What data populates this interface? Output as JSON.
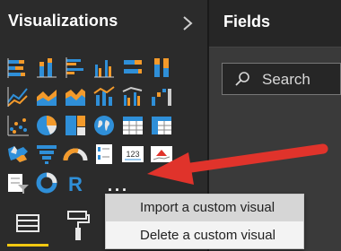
{
  "visualizations": {
    "title": "Visualizations",
    "expand_icon": "chevron-right-icon",
    "more_label": "...",
    "icons": [
      "stacked-bar-chart-icon",
      "stacked-column-chart-icon",
      "clustered-bar-chart-icon",
      "clustered-column-chart-icon",
      "100-percent-bar-chart-icon",
      "100-percent-column-chart-icon",
      "line-chart-icon",
      "area-chart-icon",
      "stacked-area-chart-icon",
      "line-and-column-chart-icon",
      "line-and-clustered-column-icon",
      "waterfall-chart-icon",
      "scatter-chart-icon",
      "pie-chart-icon",
      "treemap-icon",
      "map-icon",
      "table-icon",
      "matrix-icon",
      "filled-map-icon",
      "funnel-icon",
      "gauge-icon",
      "multi-row-card-icon",
      "card-icon",
      "kpi-icon",
      "slicer-icon",
      "donut-chart-icon",
      "r-visual-icon"
    ]
  },
  "fields": {
    "title": "Fields",
    "search_placeholder": "Search"
  },
  "bottom_tabs": {
    "fields_well": "fields-well-icon",
    "format": "paint-roller-icon"
  },
  "context_menu": {
    "items": [
      {
        "label": "Import a custom visual"
      },
      {
        "label": "Delete a custom visual"
      }
    ]
  },
  "colors": {
    "pane_background": "#2b2b2b",
    "fields_background": "#3a3a3a",
    "accent_blue": "#2f8fd8",
    "accent_orange": "#f39a2b",
    "active_tab_underline": "#f2c811",
    "annotation_arrow": "#e0332b"
  }
}
